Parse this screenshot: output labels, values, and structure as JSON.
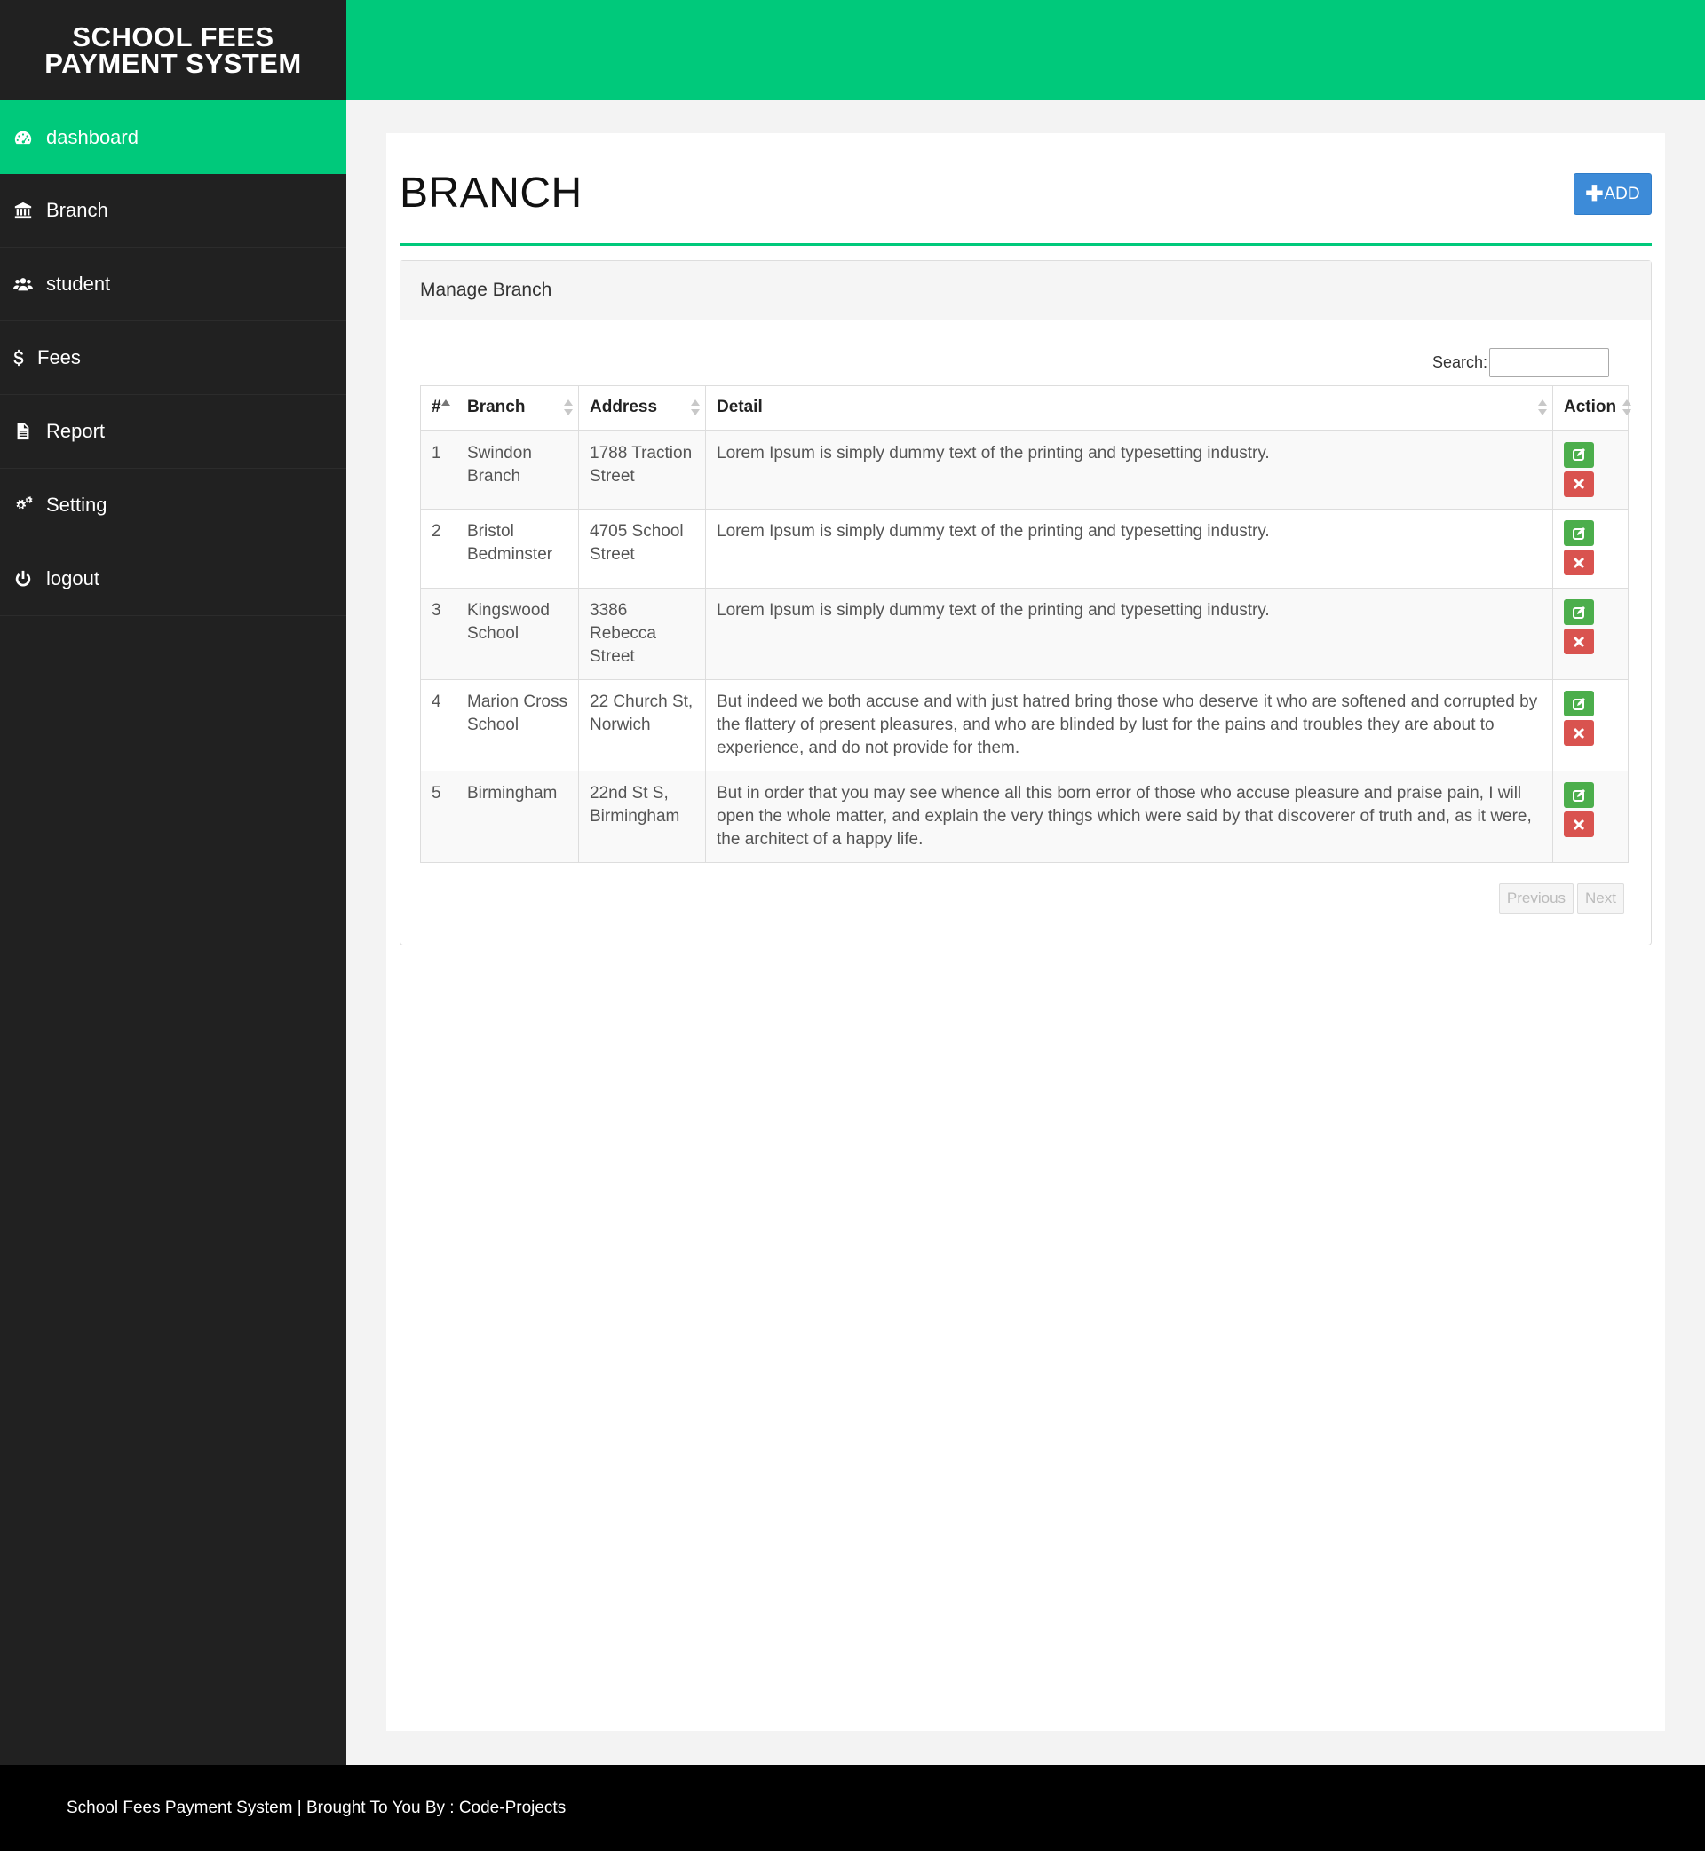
{
  "app": {
    "title_line1": "SCHOOL FEES",
    "title_line2": "PAYMENT SYSTEM"
  },
  "sidebar": {
    "items": [
      {
        "label": "dashboard",
        "icon": "dashboard-icon",
        "active": true
      },
      {
        "label": "Branch",
        "icon": "bank-icon"
      },
      {
        "label": "student",
        "icon": "users-icon"
      },
      {
        "label": "Fees",
        "icon": "dollar-icon"
      },
      {
        "label": "Report",
        "icon": "file-icon"
      },
      {
        "label": "Setting",
        "icon": "cogs-icon"
      },
      {
        "label": "logout",
        "icon": "power-icon"
      }
    ]
  },
  "header": {
    "title": "BRANCH",
    "add_label": "ADD",
    "add_icon": "plus-icon"
  },
  "card": {
    "title": "Manage Branch",
    "search_label": "Search:",
    "search_value": ""
  },
  "table": {
    "columns": [
      "#",
      "Branch",
      "Address",
      "Detail",
      "Action"
    ],
    "rows": [
      {
        "num": "1",
        "branch": "Swindon Branch",
        "address": "1788 Traction Street",
        "detail": "Lorem Ipsum is simply dummy text of the printing and typesetting industry."
      },
      {
        "num": "2",
        "branch": "Bristol Bedminster",
        "address": "4705 School Street",
        "detail": "Lorem Ipsum is simply dummy text of the printing and typesetting industry."
      },
      {
        "num": "3",
        "branch": "Kingswood School",
        "address": "3386 Rebecca Street",
        "detail": "Lorem Ipsum is simply dummy text of the printing and typesetting industry."
      },
      {
        "num": "4",
        "branch": "Marion Cross School",
        "address": "22 Church St, Norwich",
        "detail": "But indeed we both accuse and with just hatred bring those who deserve it who are softened and corrupted by the flattery of present pleasures, and who are blinded by lust for the pains and troubles they are about to experience, and do not provide for them."
      },
      {
        "num": "5",
        "branch": "Birmingham",
        "address": "22nd St S, Birmingham",
        "detail": "But in order that you may see whence all this born error of those who accuse pleasure and praise pain, I will open the whole matter, and explain the very things which were said by that discoverer of truth and, as it were, the architect of a happy life."
      }
    ]
  },
  "pager": {
    "previous": "Previous",
    "next": "Next"
  },
  "footer": {
    "text": "School Fees Payment System | Brought To You By : Code-Projects"
  },
  "colors": {
    "accent": "#00c97b",
    "sidebar": "#212121",
    "add_button": "#3d8bd8",
    "edit_button": "#4cae4c",
    "delete_button": "#d9534f"
  }
}
